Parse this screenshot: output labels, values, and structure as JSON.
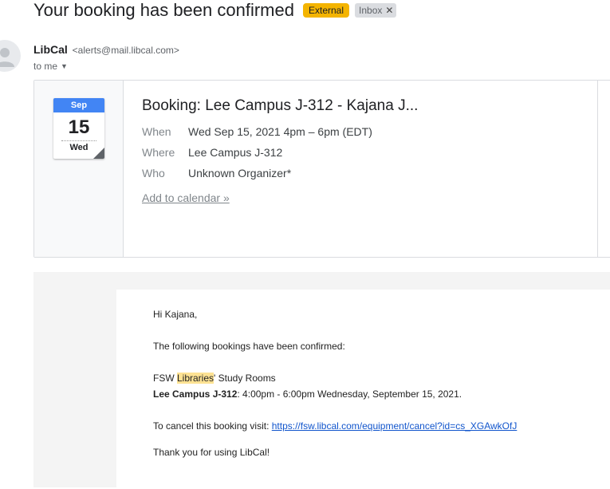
{
  "email": {
    "subject": "Your booking has been confirmed",
    "labels": {
      "external": "External",
      "inbox": "Inbox"
    },
    "sender_name": "LibCal",
    "sender_email": "<alerts@mail.libcal.com>",
    "to": "to me"
  },
  "event": {
    "calendar_month": "Sep",
    "calendar_day": "15",
    "calendar_weekday": "Wed",
    "title": "Booking: Lee Campus J-312 - Kajana J...",
    "when_label": "When",
    "when_value": "Wed Sep 15, 2021 4pm – 6pm (EDT)",
    "where_label": "Where",
    "where_value": "Lee Campus J-312",
    "who_label": "Who",
    "who_value": "Unknown Organizer*",
    "add_to_calendar": "Add to calendar »"
  },
  "message": {
    "greeting": "Hi Kajana,",
    "intro": "The following bookings have been confirmed:",
    "org_prefix": "FSW ",
    "org_highlight": "Libraries",
    "org_suffix": "' Study Rooms",
    "booking_room": "Lee Campus J-312",
    "booking_time": ": 4:00pm - 6:00pm Wednesday, September 15, 2021.",
    "cancel_prefix": "To cancel this booking visit: ",
    "cancel_link": "https://fsw.libcal.com/equipment/cancel?id=cs_XGAwkOfJ",
    "thanks": "Thank you for using LibCal!"
  },
  "colors": {
    "external_label": "#f4b400",
    "calendar_header": "#4285f4",
    "link": "#1155cc",
    "highlight": "#fde293"
  }
}
